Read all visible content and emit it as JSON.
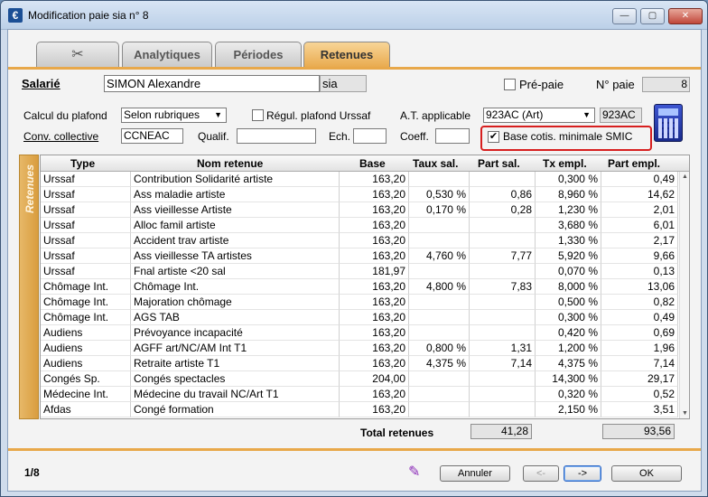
{
  "window": {
    "title": "Modification paie sia n° 8",
    "app_icon": "€",
    "controls": {
      "minimize": "—",
      "maximize": "▢",
      "close": "✕"
    }
  },
  "tabs": [
    {
      "label": "",
      "icon": "scissors-icon",
      "glyph": "✂"
    },
    {
      "label": "Analytiques"
    },
    {
      "label": "Périodes"
    },
    {
      "label": "Retenues",
      "active": true
    }
  ],
  "header": {
    "salarie_label": "Salarié",
    "salarie_value": "SIMON Alexandre",
    "salarie_code": "sia",
    "prepaie_label": "Pré-paie",
    "prepaie_checked": false,
    "npaie_label": "N° paie",
    "npaie_value": "8"
  },
  "params": {
    "calcul_label": "Calcul du plafond",
    "calcul_value": "Selon rubriques",
    "regul_label": "Régul. plafond Urssaf",
    "regul_checked": false,
    "at_label": "A.T. applicable",
    "at_value": "923AC (Art)",
    "at_code": "923AC",
    "conv_label": "Conv. collective",
    "conv_value": "CCNEAC",
    "qualif_label": "Qualif.",
    "qualif_value": "",
    "ech_label": "Ech.",
    "ech_value": "",
    "coeff_label": "Coeff.",
    "coeff_value": "",
    "smic_label": "Base cotis. minimale SMIC",
    "smic_checked": true,
    "check_glyph": "✔"
  },
  "grid": {
    "side_label": "Retenues",
    "columns": [
      "Type",
      "Nom retenue",
      "Base",
      "Taux sal.",
      "Part sal.",
      "Tx empl.",
      "Part empl."
    ],
    "rows": [
      [
        "Urssaf",
        "Contribution Solidarité artiste",
        "163,20",
        "",
        "",
        "0,300 %",
        "0,49"
      ],
      [
        "Urssaf",
        "Ass maladie artiste",
        "163,20",
        "0,530 %",
        "0,86",
        "8,960 %",
        "14,62"
      ],
      [
        "Urssaf",
        "Ass vieillesse Artiste",
        "163,20",
        "0,170 %",
        "0,28",
        "1,230 %",
        "2,01"
      ],
      [
        "Urssaf",
        "Alloc famil artiste",
        "163,20",
        "",
        "",
        "3,680 %",
        "6,01"
      ],
      [
        "Urssaf",
        "Accident trav artiste",
        "163,20",
        "",
        "",
        "1,330 %",
        "2,17"
      ],
      [
        "Urssaf",
        "Ass vieillesse TA artistes",
        "163,20",
        "4,760 %",
        "7,77",
        "5,920 %",
        "9,66"
      ],
      [
        "Urssaf",
        "Fnal artiste <20 sal",
        "181,97",
        "",
        "",
        "0,070 %",
        "0,13"
      ],
      [
        "Chômage Int.",
        "Chômage Int.",
        "163,20",
        "4,800 %",
        "7,83",
        "8,000 %",
        "13,06"
      ],
      [
        "Chômage Int.",
        "Majoration chômage",
        "163,20",
        "",
        "",
        "0,500 %",
        "0,82"
      ],
      [
        "Chômage Int.",
        "AGS TAB",
        "163,20",
        "",
        "",
        "0,300 %",
        "0,49"
      ],
      [
        "Audiens",
        "Prévoyance incapacité",
        "163,20",
        "",
        "",
        "0,420 %",
        "0,69"
      ],
      [
        "Audiens",
        "AGFF art/NC/AM Int T1",
        "163,20",
        "0,800 %",
        "1,31",
        "1,200 %",
        "1,96"
      ],
      [
        "Audiens",
        "Retraite artiste T1",
        "163,20",
        "4,375 %",
        "7,14",
        "4,375 %",
        "7,14"
      ],
      [
        "Congés Sp.",
        "Congés spectacles",
        "204,00",
        "",
        "",
        "14,300 %",
        "29,17"
      ],
      [
        "Médecine Int.",
        "Médecine du travail NC/Art T1",
        "163,20",
        "",
        "",
        "0,320 %",
        "0,52"
      ],
      [
        "Afdas",
        "Congé formation",
        "163,20",
        "",
        "",
        "2,150 %",
        "3,51"
      ]
    ],
    "scroll_up": "▲",
    "scroll_down": "▼"
  },
  "totals": {
    "label": "Total retenues",
    "part_sal": "41,28",
    "part_empl": "93,56"
  },
  "footer": {
    "pager": "1/8",
    "pencil_glyph": "✎",
    "annuler": "Annuler",
    "prev": "<-",
    "next": "->",
    "ok": "OK"
  },
  "colors": {
    "accent": "#e8a84a",
    "highlight": "#d71f1f"
  }
}
